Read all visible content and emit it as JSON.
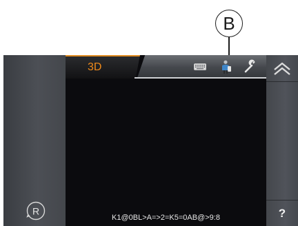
{
  "callout": {
    "label": "B"
  },
  "tabs": [
    {
      "label": "3D",
      "active": true
    }
  ],
  "toolbar_icons": [
    "keyboard-icon",
    "person-icon",
    "wrench-icon"
  ],
  "right_panel": {
    "up_icon": "double-chevron-up-icon",
    "help_label": "?"
  },
  "left_panel": {
    "icon": "registered-r-icon",
    "r_glyph": "R"
  },
  "status": {
    "text": "K1@0BL>A=>2=K5=0AB@>9:8"
  },
  "colors": {
    "accent": "#f08a1a",
    "screen_bg": "#0b0b0e",
    "panel": "#4c4f55"
  }
}
